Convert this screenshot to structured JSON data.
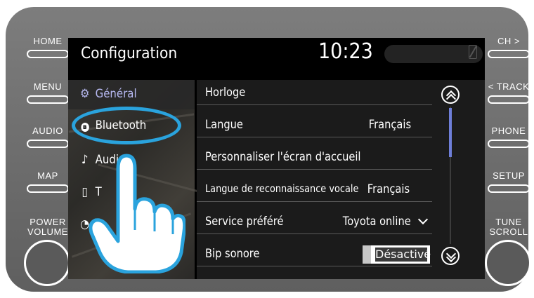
{
  "hardware_left": [
    {
      "label": "HOME"
    },
    {
      "label": "MENU"
    },
    {
      "label": "AUDIO"
    },
    {
      "label": "MAP"
    }
  ],
  "hardware_right": [
    {
      "label": "CH >"
    },
    {
      "label": "< TRACK"
    },
    {
      "label": "PHONE"
    },
    {
      "label": "SETUP"
    }
  ],
  "knobs": {
    "left_line1": "POWER",
    "left_line2": "VOLUME",
    "right_line1": "TUNE",
    "right_line2": "SCROLL"
  },
  "header": {
    "title": "Configuration",
    "clock": "10:23"
  },
  "sidebar": {
    "items": [
      {
        "label": "Général",
        "icon": "gear-icon",
        "active": true
      },
      {
        "label": "Bluetooth",
        "icon": "bluetooth-icon",
        "active": false
      },
      {
        "label": "Audio",
        "icon": "music-note-icon",
        "active": false
      },
      {
        "label": "T",
        "icon": "phone-icon",
        "active": false
      },
      {
        "label": "",
        "icon": "voice-icon",
        "active": false
      }
    ]
  },
  "settings": {
    "rows": [
      {
        "label": "Horloge",
        "value": ""
      },
      {
        "label": "Langue",
        "value": "Français"
      },
      {
        "label": "Personnaliser l'écran d'accueil",
        "value": ""
      },
      {
        "label": "Langue de reconnaissance vocale",
        "value": "Français"
      },
      {
        "label": "Service préféré",
        "value": "Toyota online"
      },
      {
        "label": "Bip sonore",
        "value": "Désactivé"
      }
    ]
  },
  "colors": {
    "accent": "#b6b8f0",
    "highlight": "#2aa3dd",
    "scroll_thumb": "#6e7ed8"
  }
}
